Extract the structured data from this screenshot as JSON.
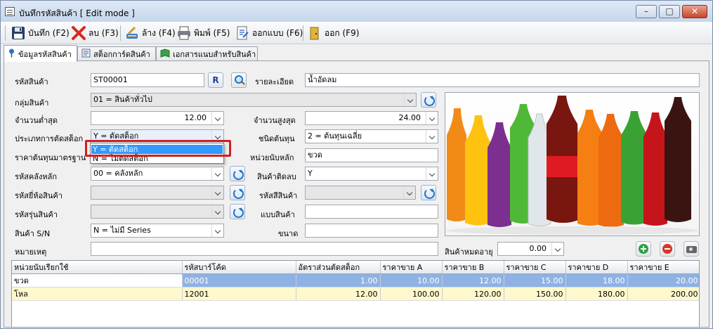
{
  "window": {
    "title": "บันทึกรหัสสินค้า [ Edit mode ]"
  },
  "toolbar": {
    "save": "บันทึก (F2)",
    "delete": "ลบ (F3)",
    "clear": "ล้าง (F4)",
    "print": "พิมพ์ (F5)",
    "design": "ออกแบบ (F6)",
    "exit": "ออก (F9)"
  },
  "tabs": [
    {
      "label": "ข้อมูลรหัสสินค้า"
    },
    {
      "label": "สต็อกการ์ดสินค้า"
    },
    {
      "label": "เอกสารแนบสำหรับสินค้า"
    }
  ],
  "form": {
    "code_label": "รหัสสินค้า",
    "code_value": "ST00001",
    "r_button": "R",
    "detail_label": "รายละเอียด",
    "detail_value": "น้ำอัดลม",
    "group_label": "กลุ่มสินค้า",
    "group_value": "01 = สินค้าทั่วไป",
    "min_label": "จำนวนต่ำสุด",
    "min_value": "12.00",
    "max_label": "จำนวนสูงสุด",
    "max_value": "24.00",
    "stockcut_label": "ประเภทการตัดสต็อก",
    "stockcut_value": "Y = ตัดสต็อก",
    "costtype_label": "ชนิดต้นทุน",
    "costtype_value": "2 = ต้นทุนเฉลี่ย",
    "stdcost_label": "ราคาต้นทุนมาตรฐาน",
    "unit_label": "หน่วยนับหลัก",
    "unit_value": "ขวด",
    "warehouse_label": "รหัสคลังหลัก",
    "warehouse_value": "00 = คลังหลัก",
    "cutneg_label": "สินค้าติดลบ",
    "cutneg_value": "Y",
    "brand_label": "รหัสยี่ห้อสินค้า",
    "color_label": "รหัสสีสินค้า",
    "model_label": "รหัสรุ่นสินค้า",
    "style_label": "แบบสินค้า",
    "sn_label": "สินค้า S/N",
    "sn_value": "N = ไม่มี Series",
    "size_label": "ขนาด",
    "remark_label": "หมายเหตุ",
    "expire_label": "สินค้าหมดอายุ",
    "expire_value": "0.00"
  },
  "dropdown": {
    "options": [
      "Y = ตัดสต็อก",
      "N = ไม่ตัดสต็อก"
    ]
  },
  "grid": {
    "columns": [
      "หน่วยนับเรียกใช้",
      "รหัสบาร์โค้ด",
      "อัตราส่วนตัดสต็อก",
      "ราคาขาย A",
      "ราคาขาย B",
      "ราคาขาย C",
      "ราคาขาย D",
      "ราคาขาย E"
    ],
    "rows": [
      [
        "ขวด",
        "00001",
        "1.00",
        "10.00",
        "12.00",
        "15.00",
        "18.00",
        "20.00"
      ],
      [
        "โหล",
        "12001",
        "12.00",
        "100.00",
        "120.00",
        "150.00",
        "180.00",
        "200.00"
      ]
    ]
  },
  "colors": {
    "selected_row": "#8fb2e4",
    "alt_row": "#fff8cc",
    "highlight_box": "#d21f1f",
    "dropdown_selection": "#3399ff"
  }
}
